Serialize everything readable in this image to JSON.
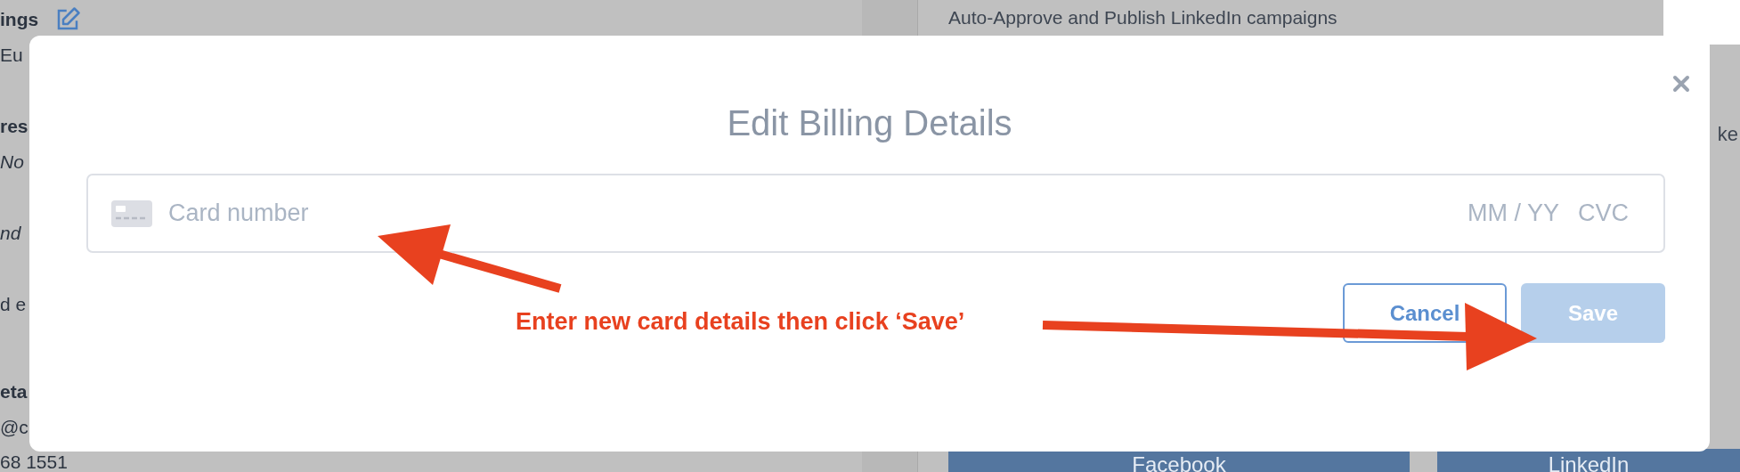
{
  "background": {
    "sections": [
      {
        "items": [
          {
            "text": "ings",
            "kind": "heading"
          },
          {
            "text": "Eu",
            "kind": "text"
          }
        ]
      },
      {
        "items": [
          {
            "text": "res",
            "kind": "heading"
          },
          {
            "text": "No",
            "kind": "italic"
          }
        ]
      },
      {
        "items": [
          {
            "text": "nd",
            "kind": "italic"
          }
        ]
      },
      {
        "items": [
          {
            "text": "d e",
            "kind": "text"
          }
        ]
      },
      {
        "items": [
          {
            "text": "eta",
            "kind": "heading"
          },
          {
            "text": "@c",
            "kind": "text"
          },
          {
            "text": "68 1551",
            "kind": "text"
          }
        ]
      }
    ],
    "top_text": "Auto-Approve and Publish LinkedIn campaigns",
    "right_text": "ke",
    "social_buttons": [
      {
        "label": "Facebook",
        "kind": "facebook"
      },
      {
        "label": "LinkedIn",
        "kind": "linkedin"
      }
    ]
  },
  "modal": {
    "title": "Edit Billing Details",
    "card_field": {
      "placeholder": "Card number",
      "expiry_placeholder": "MM / YY",
      "cvc_placeholder": "CVC"
    },
    "buttons": [
      {
        "label": "Cancel",
        "kind": "secondary",
        "disabled": false
      },
      {
        "label": "Save",
        "kind": "primary",
        "disabled": true
      }
    ]
  },
  "annotation": {
    "text": "Enter new card details then click ‘Save’"
  }
}
